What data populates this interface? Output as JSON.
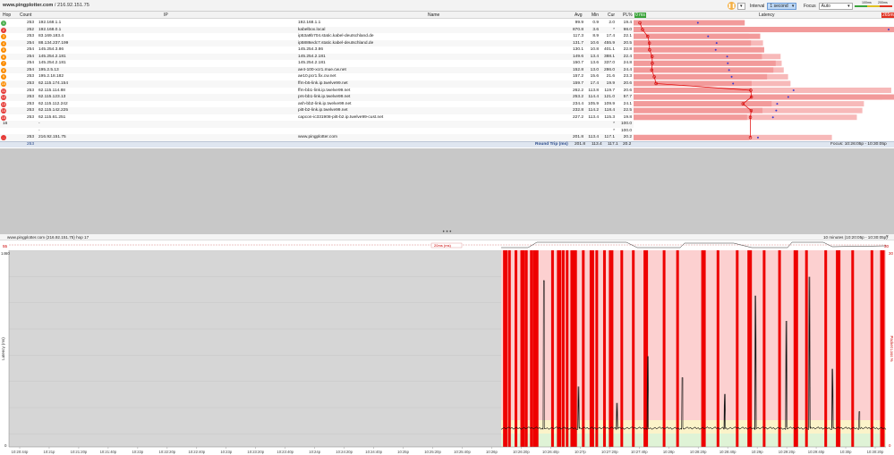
{
  "title": {
    "site": "www.pingplotter.com",
    "sep": " / ",
    "ip": "216.92.151.75"
  },
  "toolbar": {
    "pause_icon": "pause-icon",
    "interval_label": "Interval",
    "interval_value": "1 second",
    "focus_label": "Focus",
    "focus_value": "Auto",
    "legend_fast": "100ms",
    "legend_slow": "200ms"
  },
  "columns": {
    "hop": "Hop",
    "count": "Count",
    "ip": "IP",
    "name": "Name",
    "avg": "Avg",
    "min": "Min",
    "cur": "Cur",
    "pl": "PL%",
    "scale_left": "0 ms",
    "latency": "Latency",
    "scale_right": "265ms"
  },
  "hops": [
    {
      "hop": "1",
      "count": "253",
      "ip": "192.168.1.1",
      "name": "192.168.1.1",
      "avg": "99.9",
      "min": "0.9",
      "cur": "2.0",
      "pl": "19.4",
      "color": "#4caf50"
    },
    {
      "hop": "2",
      "count": "252",
      "ip": "192.168.0.1",
      "name": "kabelbox.local",
      "avg": "870.8",
      "min": "3.6",
      "cur": "*",
      "pl": "98.0",
      "color": "#e53935"
    },
    {
      "hop": "3",
      "count": "253",
      "ip": "83.169.183.4",
      "name": "ip53a9b704.static.kabel-deutschland.de",
      "avg": "117.3",
      "min": "8.9",
      "cur": "17.4",
      "pl": "22.1",
      "color": "#fb8c00"
    },
    {
      "hop": "4",
      "count": "254",
      "ip": "88.134.237.199",
      "name": "ip5886edc7.static.kabel-deutschland.de",
      "avg": "131.7",
      "min": "10.6",
      "cur": "455.9",
      "pl": "20.5",
      "color": "#fb8c00"
    },
    {
      "hop": "5",
      "count": "254",
      "ip": "145.254.3.86",
      "name": "145.254.3.86",
      "avg": "130.1",
      "min": "10.8",
      "cur": "401.1",
      "pl": "22.8",
      "color": "#fb8c00"
    },
    {
      "hop": "6",
      "count": "254",
      "ip": "145.254.2.181",
      "name": "145.254.2.181",
      "avg": "149.6",
      "min": "13.4",
      "cur": "388.1",
      "pl": "22.4",
      "color": "#fb8c00"
    },
    {
      "hop": "7",
      "count": "254",
      "ip": "145.254.2.181",
      "name": "145.254.2.181",
      "avg": "150.7",
      "min": "13.6",
      "cur": "337.0",
      "pl": "24.8",
      "color": "#fb8c00"
    },
    {
      "hop": "8",
      "count": "254",
      "ip": "195.2.5.13",
      "name": "ae4-100-xcr1.mue.cw.net",
      "avg": "152.8",
      "min": "13.0",
      "cur": "286.0",
      "pl": "24.4",
      "color": "#fb8c00"
    },
    {
      "hop": "9",
      "count": "253",
      "ip": "195.2.18.182",
      "name": "ae10.pcr1.fix.cw.net",
      "avg": "157.2",
      "min": "15.6",
      "cur": "21.6",
      "pl": "23.3",
      "color": "#fb8c00"
    },
    {
      "hop": "10",
      "count": "253",
      "ip": "62.115.174.154",
      "name": "ffm-b5-link.ip.twelve99.net",
      "avg": "159.7",
      "min": "17.4",
      "cur": "19.9",
      "pl": "20.6",
      "color": "#fb8c00"
    },
    {
      "hop": "11",
      "count": "253",
      "ip": "62.115.114.88",
      "name": "ffm-bb1-link.ip.twelve99.net",
      "avg": "262.2",
      "min": "113.8",
      "cur": "119.7",
      "pl": "20.6",
      "color": "#e53935"
    },
    {
      "hop": "12",
      "count": "253",
      "ip": "62.115.123.13",
      "name": "prs-bb1-link.ip.twelve99.net",
      "avg": "253.2",
      "min": "114.4",
      "cur": "121.0",
      "pl": "57.7",
      "color": "#e53935"
    },
    {
      "hop": "13",
      "count": "253",
      "ip": "62.115.112.242",
      "name": "ash-bb2-link.ip.twelve99.net",
      "avg": "234.4",
      "min": "105.9",
      "cur": "109.9",
      "pl": "24.1",
      "color": "#e53935"
    },
    {
      "hop": "14",
      "count": "253",
      "ip": "62.115.142.225",
      "name": "pitt-b2-link.ip.twelve99.net",
      "avg": "232.8",
      "min": "114.2",
      "cur": "118.4",
      "pl": "22.5",
      "color": "#e53935"
    },
    {
      "hop": "15",
      "count": "253",
      "ip": "62.115.61.251",
      "name": "capcon-ic331908-pitt-b2.ip.twelve99-cust.net",
      "avg": "227.2",
      "min": "113.4",
      "cur": "115.3",
      "pl": "19.8",
      "color": "#e53935"
    },
    {
      "hop": "16",
      "count": "",
      "ip": "-",
      "name": "",
      "avg": "",
      "min": "",
      "cur": "*",
      "pl": "100.0",
      "color": ""
    },
    {
      "hop": "",
      "count": "",
      "ip": "-",
      "name": "",
      "avg": "",
      "min": "",
      "cur": "*",
      "pl": "100.0",
      "color": ""
    },
    {
      "hop": "...",
      "count": "253",
      "ip": "216.92.151.75",
      "name": "www.pingplotter.com",
      "avg": "201.8",
      "min": "113.4",
      "cur": "117.1",
      "pl": "20.2",
      "color": "#e53935"
    }
  ],
  "summary": {
    "count": "253",
    "label": "Round Trip (ms)",
    "avg": "201.8",
    "min": "113.4",
    "cur": "117.1",
    "pl": "20.2",
    "focus": "Focus: 10:26:05p - 10:30:05p"
  },
  "timeline": {
    "title": "www.pingplotter.com (216.92.151.75) hop 17",
    "range": "10 minutes (10:20:05p - 10:30:05p)",
    "left_max": "55",
    "right_max": "30",
    "mini_label": "20ms (ms)",
    "ylabel": "Latency (ms)",
    "ylabel_right": "Packet Loss %",
    "y_top": "1460",
    "y_bottom": "0",
    "right_top": "30",
    "right_bottom": "0",
    "x_ticks": [
      "10:20:44p",
      "10:21p",
      "10:21:20p",
      "10:21:40p",
      "10:22p",
      "10:22:20p",
      "10:22:40p",
      "10:23p",
      "10:23:20p",
      "10:23:40p",
      "10:24p",
      "10:24:20p",
      "10:24:40p",
      "10:25p",
      "10:25:20p",
      "10:25:40p",
      "10:26p",
      "10:26:20p",
      "10:26:40p",
      "10:27p",
      "10:27:20p",
      "10:27:40p",
      "10:28p",
      "10:28:20p",
      "10:28:40p",
      "10:29p",
      "10:29:20p",
      "10:29:40p",
      "10:30p",
      "10:30:20p"
    ]
  },
  "chart_data": {
    "type": "line",
    "ylabel": "Latency (ms)",
    "ylim": [
      0,
      1460
    ],
    "x": [
      "10:26:05p",
      "10:30:05p"
    ],
    "series": [],
    "loss_bar_positions": [
      0.005,
      0.018,
      0.035,
      0.05,
      0.062,
      0.075,
      0.082,
      0.09,
      0.13,
      0.145,
      0.158,
      0.168,
      0.18,
      0.19,
      0.21,
      0.23,
      0.245,
      0.265,
      0.28,
      0.31,
      0.34,
      0.37,
      0.42,
      0.455,
      0.52,
      0.56,
      0.61,
      0.64,
      0.68,
      0.72,
      0.76,
      0.79,
      0.84,
      0.87,
      0.91,
      0.96,
      0.985
    ],
    "latency_spikes": [
      {
        "t": 0.11,
        "v": 1220
      },
      {
        "t": 0.2,
        "v": 380
      },
      {
        "t": 0.3,
        "v": 250
      },
      {
        "t": 0.38,
        "v": 620
      },
      {
        "t": 0.47,
        "v": 450
      },
      {
        "t": 0.58,
        "v": 320
      },
      {
        "t": 0.66,
        "v": 1100
      },
      {
        "t": 0.74,
        "v": 900
      },
      {
        "t": 0.8,
        "v": 1250
      },
      {
        "t": 0.86,
        "v": 520
      },
      {
        "t": 0.93,
        "v": 180
      }
    ]
  }
}
